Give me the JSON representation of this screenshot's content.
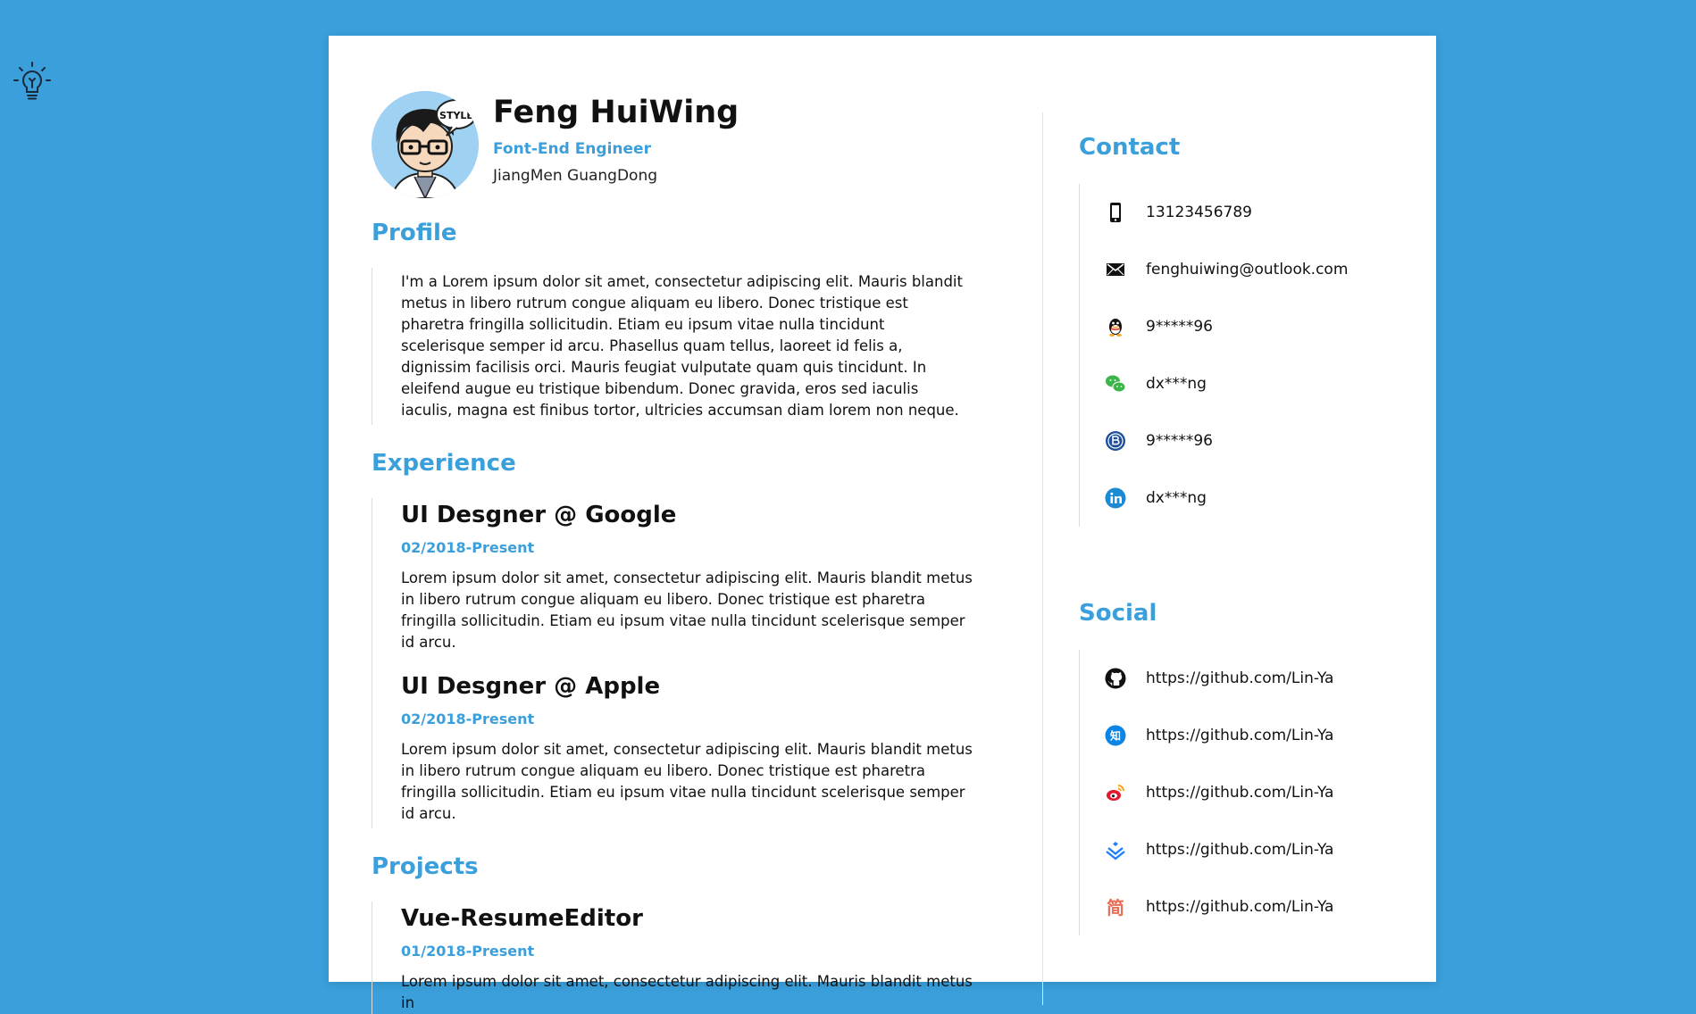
{
  "header": {
    "name": "Feng HuiWing",
    "role": "Font-End Engineer",
    "location": "JiangMen GuangDong",
    "avatar_bubble_text": "STYLE"
  },
  "sections": {
    "profile": {
      "title": "Profile",
      "text": "I'm a Lorem ipsum dolor sit amet, consectetur adipiscing elit. Mauris blandit metus in libero rutrum congue aliquam eu libero. Donec tristique est pharetra fringilla sollicitudin. Etiam eu ipsum vitae nulla tincidunt scelerisque semper id arcu. Phasellus quam tellus, laoreet id felis a, dignissim facilisis orci. Mauris feugiat vulputate quam quis tincidunt. In eleifend augue eu tristique bibendum. Donec gravida, eros sed iaculis iaculis, magna est finibus tortor, ultricies accumsan diam lorem non neque."
    },
    "experience": {
      "title": "Experience",
      "items": [
        {
          "title": "UI Desgner @ Google",
          "date": "02/2018-Present",
          "desc": "Lorem ipsum dolor sit amet, consectetur adipiscing elit. Mauris blandit metus in libero rutrum congue aliquam eu libero. Donec tristique est pharetra fringilla sollicitudin. Etiam eu ipsum vitae nulla tincidunt scelerisque semper id arcu."
        },
        {
          "title": "UI Desgner @ Apple",
          "date": "02/2018-Present",
          "desc": "Lorem ipsum dolor sit amet, consectetur adipiscing elit. Mauris blandit metus in libero rutrum congue aliquam eu libero. Donec tristique est pharetra fringilla sollicitudin. Etiam eu ipsum vitae nulla tincidunt scelerisque semper id arcu."
        }
      ]
    },
    "projects": {
      "title": "Projects",
      "items": [
        {
          "title": "Vue-ResumeEditor",
          "date": "01/2018-Present",
          "desc": "Lorem ipsum dolor sit amet, consectetur adipiscing elit. Mauris blandit metus in"
        }
      ]
    }
  },
  "contact": {
    "title": "Contact",
    "items": [
      {
        "icon": "phone-icon",
        "text": "13123456789"
      },
      {
        "icon": "email-icon",
        "text": "fenghuiwing@outlook.com"
      },
      {
        "icon": "qq-icon",
        "text": "9*****96"
      },
      {
        "icon": "wechat-icon",
        "text": "dx***ng"
      },
      {
        "icon": "blog-icon",
        "text": "9*****96"
      },
      {
        "icon": "linkedin-icon",
        "text": "dx***ng"
      }
    ]
  },
  "social": {
    "title": "Social",
    "items": [
      {
        "icon": "github-icon",
        "text": "https://github.com/Lin-Ya"
      },
      {
        "icon": "zhihu-icon",
        "text": "https://github.com/Lin-Ya"
      },
      {
        "icon": "weibo-icon",
        "text": "https://github.com/Lin-Ya"
      },
      {
        "icon": "juejin-icon",
        "text": "https://github.com/Lin-Ya"
      },
      {
        "icon": "jianshu-icon",
        "text": "https://github.com/Lin-Ya"
      }
    ]
  },
  "colors": {
    "background": "#3a9fdb",
    "accent": "#3a9fdb",
    "paper": "#ffffff"
  }
}
